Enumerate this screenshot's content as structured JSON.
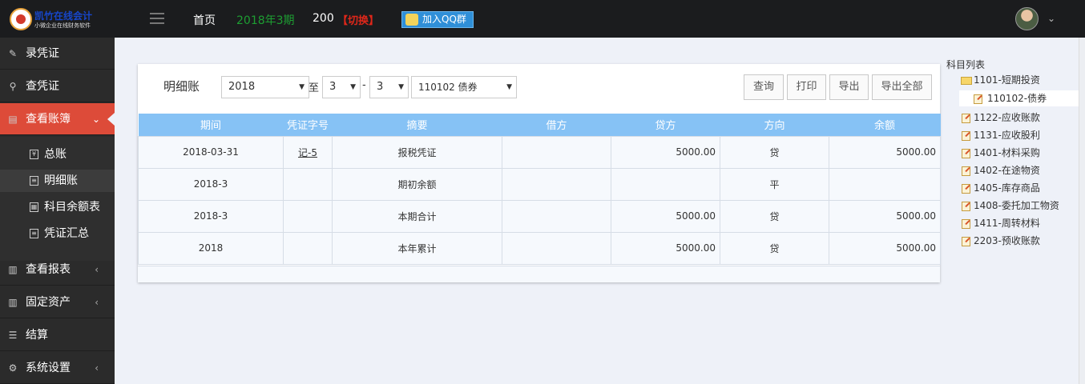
{
  "header": {
    "logo_name": "凯竹在线会计",
    "logo_sub": "小微企业在线财务软件",
    "home": "首页",
    "period": "2018年3期",
    "count": "200",
    "switch": "【切换】",
    "qq_button": "加入QQ群"
  },
  "sidebar": {
    "items": [
      {
        "label": "录凭证",
        "icon": "edit-icon"
      },
      {
        "label": "查凭证",
        "icon": "search-icon"
      },
      {
        "label": "查看账簿",
        "icon": "book-icon"
      },
      {
        "label": "查看报表",
        "icon": "bar-chart-icon"
      },
      {
        "label": "固定资产",
        "icon": "bar-chart-icon"
      },
      {
        "label": "结算",
        "icon": "list-icon"
      },
      {
        "label": "系统设置",
        "icon": "gear-icon"
      }
    ],
    "sub_items": [
      {
        "label": "总账",
        "icon": "yen-icon"
      },
      {
        "label": "明细账",
        "icon": "document-icon"
      },
      {
        "label": "科目余额表",
        "icon": "grid-icon"
      },
      {
        "label": "凭证汇总",
        "icon": "list-icon"
      }
    ]
  },
  "toolbar": {
    "title": "明细账",
    "year": "2018",
    "to_label": "至",
    "dash": "-",
    "month_from": "3",
    "month_to": "3",
    "account": "110102  债券",
    "buttons": [
      "查询",
      "打印",
      "导出",
      "导出全部"
    ]
  },
  "table": {
    "headers": [
      "期间",
      "凭证字号",
      "摘要",
      "借方",
      "贷方",
      "方向",
      "余额"
    ],
    "rows": [
      [
        "2018-03-31",
        "记-5",
        "报税凭证",
        "",
        "5000.00",
        "贷",
        "5000.00"
      ],
      [
        "2018-3",
        "",
        "期初余额",
        "",
        "",
        "平",
        ""
      ],
      [
        "2018-3",
        "",
        "本期合计",
        "",
        "5000.00",
        "贷",
        "5000.00"
      ],
      [
        "2018",
        "",
        "本年累计",
        "",
        "5000.00",
        "贷",
        "5000.00"
      ]
    ]
  },
  "tree": {
    "title": "科目列表",
    "nodes": [
      {
        "label": "1101-短期投资",
        "type": "folder"
      },
      {
        "label": "110102-债券",
        "type": "file",
        "selected": true
      },
      {
        "label": "1122-应收账款",
        "type": "file"
      },
      {
        "label": "1131-应收股利",
        "type": "file"
      },
      {
        "label": "1401-材料采购",
        "type": "file"
      },
      {
        "label": "1402-在途物资",
        "type": "file"
      },
      {
        "label": "1405-库存商品",
        "type": "file"
      },
      {
        "label": "1408-委托加工物资",
        "type": "file"
      },
      {
        "label": "1411-周转材料",
        "type": "file"
      },
      {
        "label": "2203-预收账款",
        "type": "file"
      }
    ]
  },
  "colors": {
    "accent_red": "#dd4b39",
    "table_header": "#86c2f5",
    "period_green": "#1d9e32",
    "switch_red": "#e0271a"
  }
}
